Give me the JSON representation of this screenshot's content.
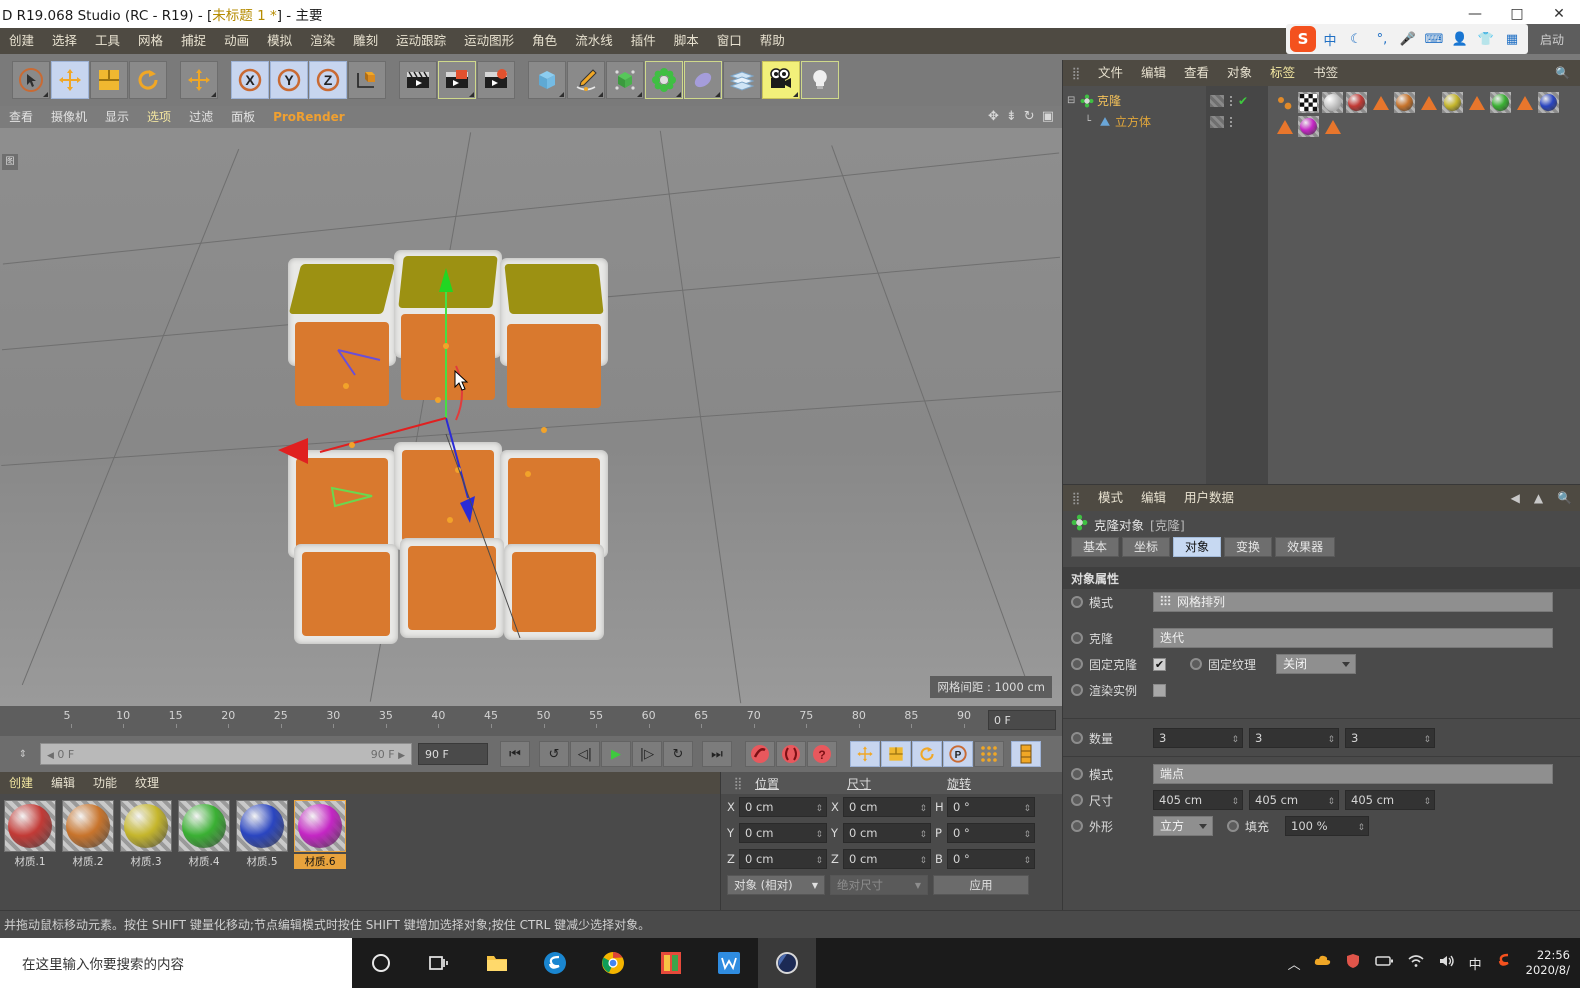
{
  "titlebar": {
    "text_pre": "D R19.068 Studio (RC - R19) - [",
    "text_hl": "未标题 1 *",
    "text_post": "] - 主要",
    "minimize": "—",
    "maximize": "□",
    "close": "✕"
  },
  "menubar": {
    "items": [
      {
        "label": "创建"
      },
      {
        "label": "选择"
      },
      {
        "label": "工具"
      },
      {
        "label": "网格"
      },
      {
        "label": "捕捉"
      },
      {
        "label": "动画"
      },
      {
        "label": "模拟"
      },
      {
        "label": "渲染"
      },
      {
        "label": "雕刻"
      },
      {
        "label": "运动跟踪"
      },
      {
        "label": "运动图形"
      },
      {
        "label": "角色"
      },
      {
        "label": "流水线"
      },
      {
        "label": "插件"
      },
      {
        "label": "脚本"
      },
      {
        "label": "窗口"
      },
      {
        "label": "帮助"
      }
    ]
  },
  "ime": {
    "lang": "中",
    "icons": [
      "sogou-logo-icon",
      "chinese-mode-icon",
      "moon-icon",
      "punctuation-icon",
      "microphone-icon",
      "soft-keyboard-icon",
      "user-icon",
      "skin-icon",
      "toolbox-icon"
    ],
    "start_label": "启动"
  },
  "viewport": {
    "menu": [
      {
        "label": "查看"
      },
      {
        "label": "摄像机"
      },
      {
        "label": "显示"
      },
      {
        "label": "选项",
        "hl": true
      },
      {
        "label": "过滤"
      },
      {
        "label": "面板"
      },
      {
        "label": "ProRender",
        "pr": true
      }
    ],
    "grid_label": "网格间距 : 1000 cm",
    "axis_badge": "图",
    "cube_color_front": "#d9792e",
    "cube_color_top": "#9c9112",
    "cube_body_color": "#e8e8e6"
  },
  "timeline": {
    "ticks": [
      5,
      10,
      15,
      20,
      25,
      30,
      35,
      40,
      45,
      50,
      55,
      60,
      65,
      70,
      75,
      80,
      85,
      90
    ],
    "frame_field": "0 F",
    "scrub_start": "0 F",
    "scrub_end": "90 F",
    "end_field": "90 F",
    "transport": [
      {
        "name": "go-to-start-icon",
        "glyph": "|◀"
      },
      {
        "name": "previous-keyframe-icon",
        "glyph": "↺"
      },
      {
        "name": "step-back-icon",
        "glyph": "◀|"
      },
      {
        "name": "play-icon",
        "glyph": "▶"
      },
      {
        "name": "step-forward-icon",
        "glyph": "|▶"
      },
      {
        "name": "next-keyframe-icon",
        "glyph": "↻"
      },
      {
        "name": "go-to-end-icon",
        "glyph": "▶|"
      }
    ]
  },
  "materials": {
    "menu": [
      {
        "label": "创建",
        "hl": true
      },
      {
        "label": "编辑"
      },
      {
        "label": "功能"
      },
      {
        "label": "纹理"
      }
    ],
    "items": [
      {
        "name": "材质.1",
        "color": "#c23a36",
        "selected": false
      },
      {
        "name": "材质.2",
        "color": "#c8742c",
        "selected": false
      },
      {
        "name": "材质.3",
        "color": "#c5b62c",
        "selected": false
      },
      {
        "name": "材质.4",
        "color": "#3ab033",
        "selected": false
      },
      {
        "name": "材质.5",
        "color": "#2a45c0",
        "selected": false
      },
      {
        "name": "材质.6",
        "color": "#c426c4",
        "selected": true
      }
    ]
  },
  "coordinates": {
    "headers": [
      "位置",
      "尺寸",
      "旋转"
    ],
    "rows": [
      {
        "pos_label": "X",
        "pos_value": "0 cm",
        "size_label": "X",
        "size_value": "0 cm",
        "rot_label": "H",
        "rot_value": "0 °"
      },
      {
        "pos_label": "Y",
        "pos_value": "0 cm",
        "size_label": "Y",
        "size_value": "0 cm",
        "rot_label": "P",
        "rot_value": "0 °"
      },
      {
        "pos_label": "Z",
        "pos_value": "0 cm",
        "size_label": "Z",
        "size_value": "0 cm",
        "rot_label": "B",
        "rot_value": "0 °"
      }
    ],
    "mode_dropdown": "对象 (相对)",
    "size_dropdown": "绝对尺寸",
    "apply_button": "应用"
  },
  "object_manager": {
    "menu": [
      {
        "label": "文件"
      },
      {
        "label": "编辑"
      },
      {
        "label": "查看"
      },
      {
        "label": "对象"
      },
      {
        "label": "标签",
        "hl": true
      },
      {
        "label": "书签"
      }
    ],
    "tree": [
      {
        "name": "克隆",
        "icon": "cloner-icon",
        "depth": 0,
        "selected": true,
        "check": "✔"
      },
      {
        "name": "立方体",
        "icon": "cube-icon",
        "depth": 1,
        "selected": false,
        "check": ""
      }
    ],
    "tag_colors": [
      "#c23a36",
      "#c8742c",
      "#c5b62c",
      "#3ab033",
      "#2a45c0",
      "#c426c4"
    ],
    "search_icon": "search-icon"
  },
  "attributes": {
    "menu": [
      {
        "label": "模式"
      },
      {
        "label": "编辑"
      },
      {
        "label": "用户数据"
      }
    ],
    "title": "克隆对象",
    "title_sub": "[克隆]",
    "tabs": [
      {
        "label": "基本",
        "selected": false
      },
      {
        "label": "坐标",
        "selected": false
      },
      {
        "label": "对象",
        "selected": true
      },
      {
        "label": "变换",
        "selected": false
      },
      {
        "label": "效果器",
        "selected": false
      }
    ],
    "section_title": "对象属性",
    "props": {
      "mode_label": "模式",
      "mode_value": "网格排列",
      "clone_label": "克隆",
      "clone_value": "迭代",
      "fix_clone_label": "固定克隆",
      "fix_clone_checked": "✔",
      "fix_texture_label": "固定纹理",
      "fix_texture_value": "关闭",
      "render_instance_label": "渲染实例",
      "count_label": "数量",
      "count_values": [
        "3",
        "3",
        "3"
      ],
      "mode2_label": "模式",
      "mode2_value": "端点",
      "size_label": "尺寸",
      "size_values": [
        "405 cm",
        "405 cm",
        "405 cm"
      ],
      "shape_label": "外形",
      "shape_value": "立方",
      "fill_label": "填充",
      "fill_value": "100 %"
    }
  },
  "statusbar": {
    "text": "并拖动鼠标移动元素。按住 SHIFT 键量化移动;节点编辑模式时按住 SHIFT 键增加选择对象;按住 CTRL 键减少选择对象。"
  },
  "taskbar": {
    "search_placeholder": "在这里输入你要搜索的内容",
    "icons": [
      {
        "name": "cortana-icon",
        "glyph": "◯"
      },
      {
        "name": "task-view-icon",
        "glyph": "❏|"
      },
      {
        "name": "file-explorer-icon",
        "glyph": "▤"
      },
      {
        "name": "sogou-browser-icon",
        "glyph": "S"
      },
      {
        "name": "chrome-icon",
        "glyph": "◉"
      },
      {
        "name": "app-icon",
        "glyph": "▥"
      },
      {
        "name": "wps-icon",
        "glyph": "W"
      },
      {
        "name": "cinema4d-icon",
        "glyph": "◓"
      }
    ],
    "tray": [
      {
        "name": "battery-icon",
        "glyph": "▭"
      },
      {
        "name": "wifi-icon",
        "glyph": "◞"
      },
      {
        "name": "volume-icon",
        "glyph": "🕪"
      },
      {
        "name": "ime-lang-icon",
        "glyph": "中"
      },
      {
        "name": "sogou-tray-icon",
        "glyph": "S"
      }
    ],
    "clock_time": "22:56",
    "clock_date": "2020/8/"
  }
}
